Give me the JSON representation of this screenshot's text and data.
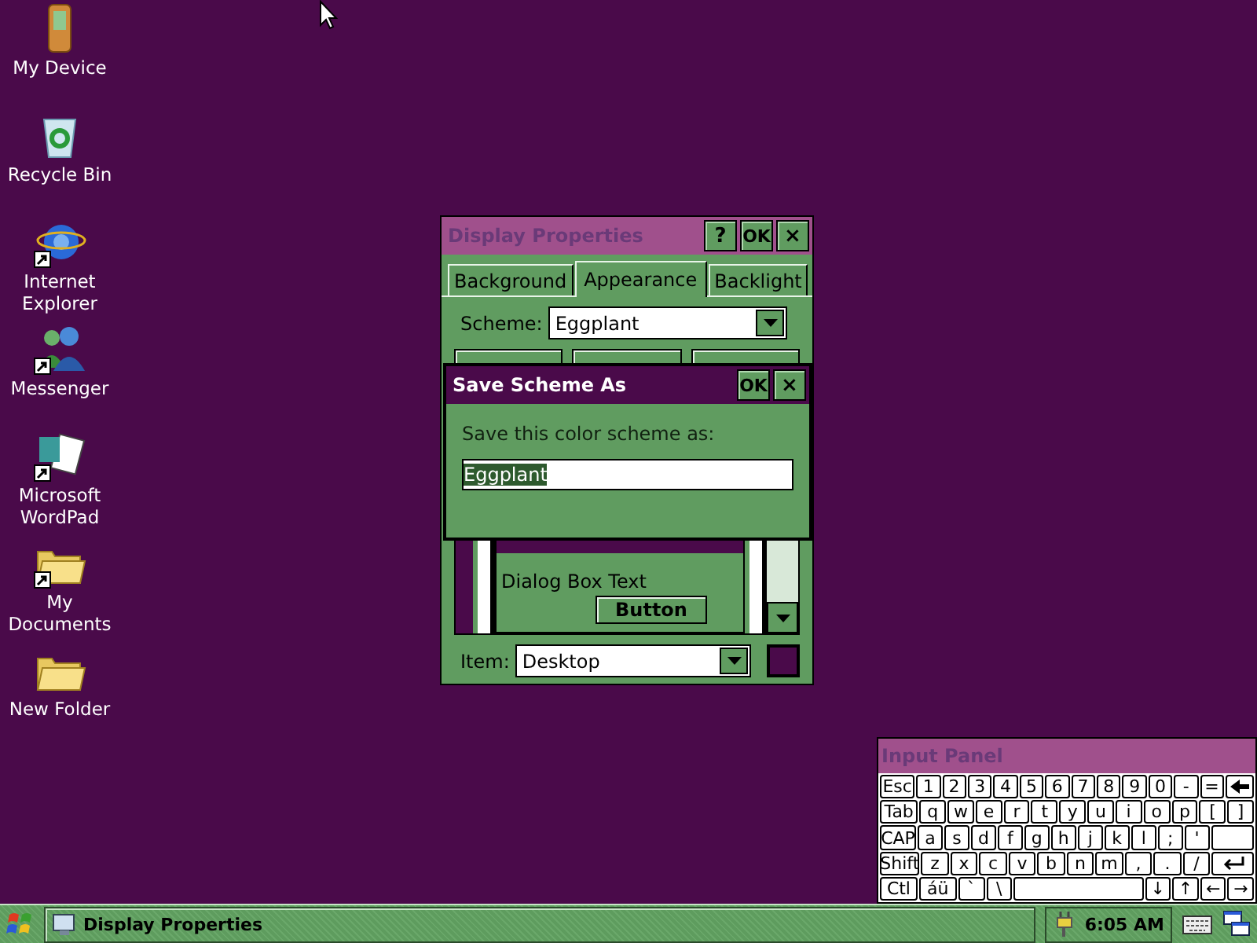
{
  "desktop_icons": [
    {
      "label": "My Device",
      "kind": "device",
      "shortcut": false
    },
    {
      "label": "Recycle Bin",
      "kind": "recycle",
      "shortcut": false
    },
    {
      "label": "Internet Explorer",
      "kind": "browser",
      "shortcut": true
    },
    {
      "label": "Messenger",
      "kind": "people",
      "shortcut": true
    },
    {
      "label": "Microsoft WordPad",
      "kind": "document",
      "shortcut": true
    },
    {
      "label": "My Documents",
      "kind": "folder",
      "shortcut": true
    },
    {
      "label": "New Folder",
      "kind": "folder",
      "shortcut": false
    }
  ],
  "display_properties": {
    "title": "Display Properties",
    "active": false,
    "title_buttons": [
      {
        "label": "?",
        "kind": "help"
      },
      {
        "label": "OK",
        "kind": "ok"
      },
      {
        "label": "×",
        "kind": "close"
      }
    ],
    "tabs": [
      {
        "label": "Background",
        "selected": false
      },
      {
        "label": "Appearance",
        "selected": true
      },
      {
        "label": "Backlight",
        "selected": false
      }
    ],
    "scheme": {
      "label": "Scheme:",
      "value": "Eggplant"
    },
    "preview": {
      "text": "Dialog Box Text",
      "button": "Button"
    },
    "item": {
      "label": "Item:",
      "value": "Desktop",
      "color": "#4a0a4a"
    }
  },
  "dialog": {
    "title": "Save Scheme As",
    "active": true,
    "title_buttons": [
      {
        "label": "OK",
        "kind": "ok"
      },
      {
        "label": "×",
        "kind": "close"
      }
    ],
    "prompt": "Save this color scheme as:",
    "value": "Eggplant",
    "value_highlighted": true
  },
  "input_panel": {
    "title": "Input Panel",
    "rows": [
      {
        "keys": [
          {
            "label": "Esc",
            "kind": "wide"
          },
          {
            "label": "1",
            "kind": "key"
          },
          {
            "label": "2",
            "kind": "key"
          },
          {
            "label": "3",
            "kind": "key"
          },
          {
            "label": "4",
            "kind": "key"
          },
          {
            "label": "5",
            "kind": "key"
          },
          {
            "label": "6",
            "kind": "key"
          },
          {
            "label": "7",
            "kind": "key"
          },
          {
            "label": "8",
            "kind": "key"
          },
          {
            "label": "9",
            "kind": "key"
          },
          {
            "label": "0",
            "kind": "key"
          },
          {
            "label": "-",
            "kind": "key"
          },
          {
            "label": "=",
            "kind": "key"
          },
          {
            "kind": "backspace"
          }
        ]
      },
      {
        "keys": [
          {
            "label": "Tab",
            "kind": "wide"
          },
          {
            "label": "q",
            "kind": "key"
          },
          {
            "label": "w",
            "kind": "key"
          },
          {
            "label": "e",
            "kind": "key"
          },
          {
            "label": "r",
            "kind": "key"
          },
          {
            "label": "t",
            "kind": "key"
          },
          {
            "label": "y",
            "kind": "key"
          },
          {
            "label": "u",
            "kind": "key"
          },
          {
            "label": "i",
            "kind": "key"
          },
          {
            "label": "o",
            "kind": "key"
          },
          {
            "label": "p",
            "kind": "key"
          },
          {
            "label": "[",
            "kind": "key"
          },
          {
            "label": "]",
            "kind": "key"
          }
        ]
      },
      {
        "keys": [
          {
            "label": "CAP",
            "kind": "wide"
          },
          {
            "label": "a",
            "kind": "key"
          },
          {
            "label": "s",
            "kind": "key"
          },
          {
            "label": "d",
            "kind": "key"
          },
          {
            "label": "f",
            "kind": "key"
          },
          {
            "label": "g",
            "kind": "key"
          },
          {
            "label": "h",
            "kind": "key"
          },
          {
            "label": "j",
            "kind": "key"
          },
          {
            "label": "k",
            "kind": "key"
          },
          {
            "label": "l",
            "kind": "key"
          },
          {
            "label": ";",
            "kind": "key"
          },
          {
            "label": "'",
            "kind": "key"
          },
          {
            "kind": "blank"
          }
        ]
      },
      {
        "keys": [
          {
            "label": "Shift",
            "kind": "wide"
          },
          {
            "label": "z",
            "kind": "key"
          },
          {
            "label": "x",
            "kind": "key"
          },
          {
            "label": "c",
            "kind": "key"
          },
          {
            "label": "v",
            "kind": "key"
          },
          {
            "label": "b",
            "kind": "key"
          },
          {
            "label": "n",
            "kind": "key"
          },
          {
            "label": "m",
            "kind": "key"
          },
          {
            "label": ",",
            "kind": "key"
          },
          {
            "label": ".",
            "kind": "key"
          },
          {
            "label": "/",
            "kind": "key"
          },
          {
            "kind": "enter"
          }
        ]
      },
      {
        "keys": [
          {
            "label": "Ctl",
            "kind": "wide"
          },
          {
            "label": "áü",
            "kind": "wide"
          },
          {
            "label": "`",
            "kind": "key"
          },
          {
            "label": "\\",
            "kind": "key"
          },
          {
            "kind": "space"
          },
          {
            "label": "↓",
            "kind": "key"
          },
          {
            "label": "↑",
            "kind": "key"
          },
          {
            "label": "←",
            "kind": "key"
          },
          {
            "label": "→",
            "kind": "key"
          }
        ]
      }
    ]
  },
  "taskbar": {
    "task": "Display Properties",
    "time": "6:05 AM"
  }
}
